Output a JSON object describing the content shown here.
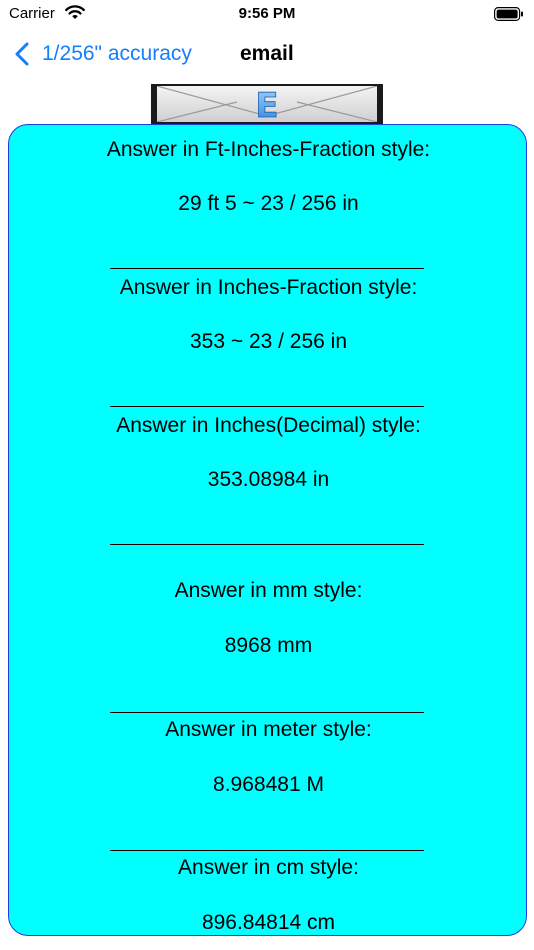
{
  "status_bar": {
    "carrier": "Carrier",
    "time": "9:56 PM"
  },
  "nav": {
    "back_label": "1/256\" accuracy",
    "title": "email",
    "accent_color": "#147efb"
  },
  "email_button": {
    "letter": "E",
    "icon": "envelope-icon"
  },
  "answers": {
    "background_color": "#00ffff",
    "ft_inches": {
      "label": "Answer in Ft-Inches-Fraction style:",
      "value": "29 ft 5 ~ 23 / 256 in"
    },
    "inches_fraction": {
      "label": "Answer in Inches-Fraction style:",
      "value": "353 ~ 23 / 256 in"
    },
    "inches_decimal": {
      "label": "Answer in Inches(Decimal) style:",
      "value": "353.08984 in"
    },
    "mm": {
      "label": "Answer in mm style:",
      "value": "8968 mm"
    },
    "meter": {
      "label": "Answer in meter style:",
      "value": "8.968481 M"
    },
    "cm": {
      "label": "Answer in cm style:",
      "value": "896.84814 cm"
    }
  }
}
